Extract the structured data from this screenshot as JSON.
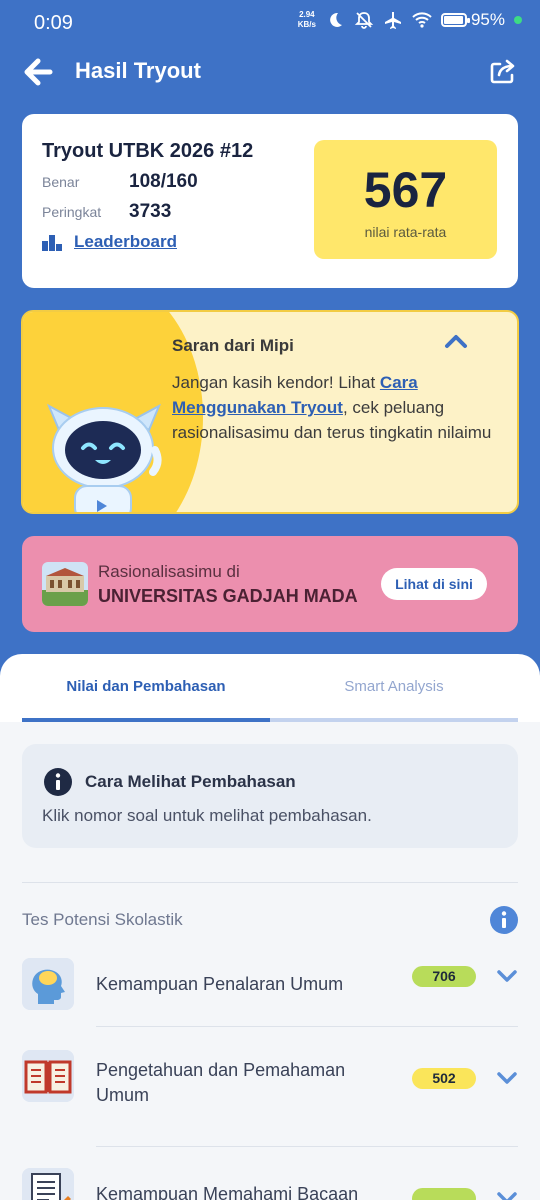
{
  "status": {
    "time": "0:09",
    "netspeed_top": "2.94",
    "netspeed_bottom": "KB/s",
    "battery_pct": "95%",
    "battery_level": 0.95
  },
  "app_bar": {
    "title": "Hasil Tryout"
  },
  "score_card": {
    "title": "Tryout UTBK 2026 #12",
    "benar_label": "Benar",
    "benar_value": "108/160",
    "peringkat_label": "Peringkat",
    "peringkat_value": "3733",
    "leaderboard_label": "Leaderboard",
    "score": "567",
    "score_caption": "nilai rata-rata"
  },
  "saran": {
    "title": "Saran dari Mipi",
    "text_before": "Jangan kasih kendor! Lihat ",
    "link": "Cara Menggunakan Tryout",
    "text_after": ", cek peluang rasionalisasimu dan terus tingkatin nilaimu"
  },
  "rasio": {
    "label": "Rasionalisasimu di",
    "university": "UNIVERSITAS GADJAH MADA",
    "button": "Lihat di sini"
  },
  "tabs": [
    {
      "label": "Nilai dan Pembahasan",
      "active": true
    },
    {
      "label": "Smart Analysis",
      "active": false
    }
  ],
  "info": {
    "title": "Cara Melihat Pembahasan",
    "text": "Klik nomor soal untuk melihat pembahasan."
  },
  "section": {
    "title": "Tes Potensi Skolastik"
  },
  "subtests": [
    {
      "name": "Kemampuan Penalaran Umum",
      "score": "706",
      "color": "#b8dc5a"
    },
    {
      "name": "Pengetahuan dan Pemahaman Umum",
      "score": "502",
      "color": "#fae55a"
    },
    {
      "name": "Kemampuan Memahami Bacaan",
      "score": "",
      "color": "#b8dc5a"
    }
  ],
  "colors": {
    "primary": "#3e72c6",
    "accent_yellow": "#ffe76b",
    "pink_card": "#ec8fae",
    "link": "#2d5fb4"
  }
}
